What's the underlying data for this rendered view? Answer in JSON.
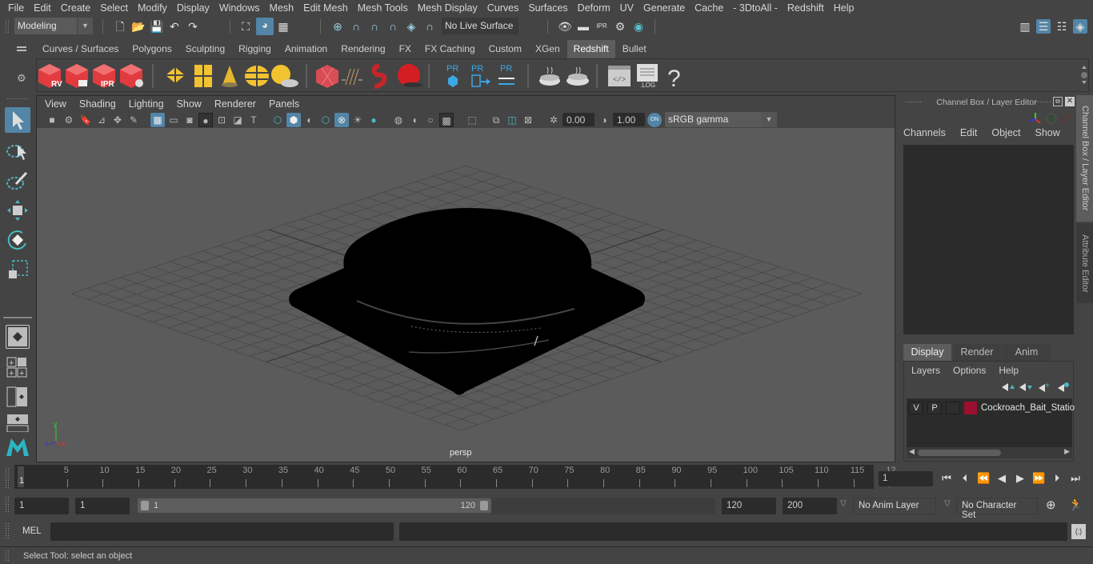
{
  "menubar": [
    "File",
    "Edit",
    "Create",
    "Select",
    "Modify",
    "Display",
    "Windows",
    "Mesh",
    "Edit Mesh",
    "Mesh Tools",
    "Mesh Display",
    "Curves",
    "Surfaces",
    "Deform",
    "UV",
    "Generate",
    "Cache",
    "- 3DtoAll -",
    "Redshift",
    "Help"
  ],
  "statusline": {
    "mode": "Modeling",
    "live_surface": "No Live Surface",
    "icons": [
      "new-scene-icon",
      "open-scene-icon",
      "save-scene-icon",
      "undo-icon",
      "redo-icon",
      "select-hierarchy-icon",
      "select-object-icon",
      "select-component-icon",
      "snap-grid-icon",
      "snap-curve-icon",
      "snap-point-icon",
      "snap-view-plane-icon",
      "snap-surface-icon",
      "make-live-icon",
      "render-view-icon",
      "render-frame-icon",
      "ipr-render-icon",
      "render-settings-icon",
      "hypershade-icon"
    ],
    "right_icons": [
      "modeling-toolkit-icon",
      "attribute-editor-icon",
      "tool-settings-icon",
      "channel-box-icon"
    ]
  },
  "shelf": {
    "tabs": [
      "Curves / Surfaces",
      "Polygons",
      "Sculpting",
      "Rigging",
      "Animation",
      "Rendering",
      "FX",
      "FX Caching",
      "Custom",
      "XGen",
      "Redshift",
      "Bullet"
    ],
    "active_tab": "Redshift",
    "icons": [
      {
        "name": "rs-render-view-icon",
        "label": "RV"
      },
      {
        "name": "rs-render-sequence-icon",
        "label": ""
      },
      {
        "name": "rs-ipr-icon",
        "label": "IPR"
      },
      {
        "name": "rs-render-settings-icon",
        "label": ""
      },
      {
        "name": "rs-area-light-icon",
        "label": ""
      },
      {
        "name": "rs-portal-light-icon",
        "label": ""
      },
      {
        "name": "rs-physical-light-icon",
        "label": ""
      },
      {
        "name": "rs-dome-light-icon",
        "label": ""
      },
      {
        "name": "rs-sun-sky-icon",
        "label": ""
      },
      {
        "name": "rs-proxy-icon",
        "label": ""
      },
      {
        "name": "rs-hair-icon",
        "label": ""
      },
      {
        "name": "rs-volume-icon",
        "label": ""
      },
      {
        "name": "rs-material-icon",
        "label": ""
      },
      {
        "name": "pr-export-icon",
        "label": "PR"
      },
      {
        "name": "pr-import-icon",
        "label": "PR"
      },
      {
        "name": "pr-sync-icon",
        "label": "PR"
      },
      {
        "name": "rs-bake-set-icon",
        "label": ""
      },
      {
        "name": "rs-bake-icon",
        "label": ""
      },
      {
        "name": "rs-script-editor-icon",
        "label": "</>"
      },
      {
        "name": "rs-log-icon",
        "label": ".LOG"
      },
      {
        "name": "rs-help-icon",
        "label": "?"
      }
    ]
  },
  "viewport": {
    "menu": [
      "View",
      "Shading",
      "Lighting",
      "Show",
      "Renderer",
      "Panels"
    ],
    "exposure": "0.00",
    "gamma": "1.00",
    "color_management": "ON",
    "color_space": "sRGB gamma",
    "camera_label": "persp",
    "axis": {
      "x": "x",
      "y": "y",
      "z": "z"
    }
  },
  "channel_box": {
    "title": "Channel Box / Layer Editor",
    "menu": [
      "Channels",
      "Edit",
      "Object",
      "Show"
    ]
  },
  "layer_editor": {
    "tabs": [
      "Display",
      "Render",
      "Anim"
    ],
    "active_tab": "Display",
    "menu": [
      "Layers",
      "Options",
      "Help"
    ],
    "layers": [
      {
        "visible": "V",
        "playback": "P",
        "color": "#9b0f2e",
        "name": "Cockroach_Bait_Statio"
      }
    ]
  },
  "side_tabs": [
    "Channel Box / Layer Editor",
    "Attribute Editor"
  ],
  "timeline": {
    "start_marker": "1",
    "ticks": [
      "5",
      "10",
      "15",
      "20",
      "25",
      "30",
      "35",
      "40",
      "45",
      "50",
      "55",
      "60",
      "65",
      "70",
      "75",
      "80",
      "85",
      "90",
      "95",
      "100",
      "105",
      "110",
      "115",
      "12"
    ],
    "current_frame": "1"
  },
  "range": {
    "start": "1",
    "playback_start": "1",
    "slider_min": "1",
    "slider_max": "120",
    "playback_end": "120",
    "end": "200",
    "anim_layer": "No Anim Layer",
    "character_set": "No Character Set"
  },
  "command": {
    "language": "MEL"
  },
  "help_line": "Select Tool: select an object"
}
